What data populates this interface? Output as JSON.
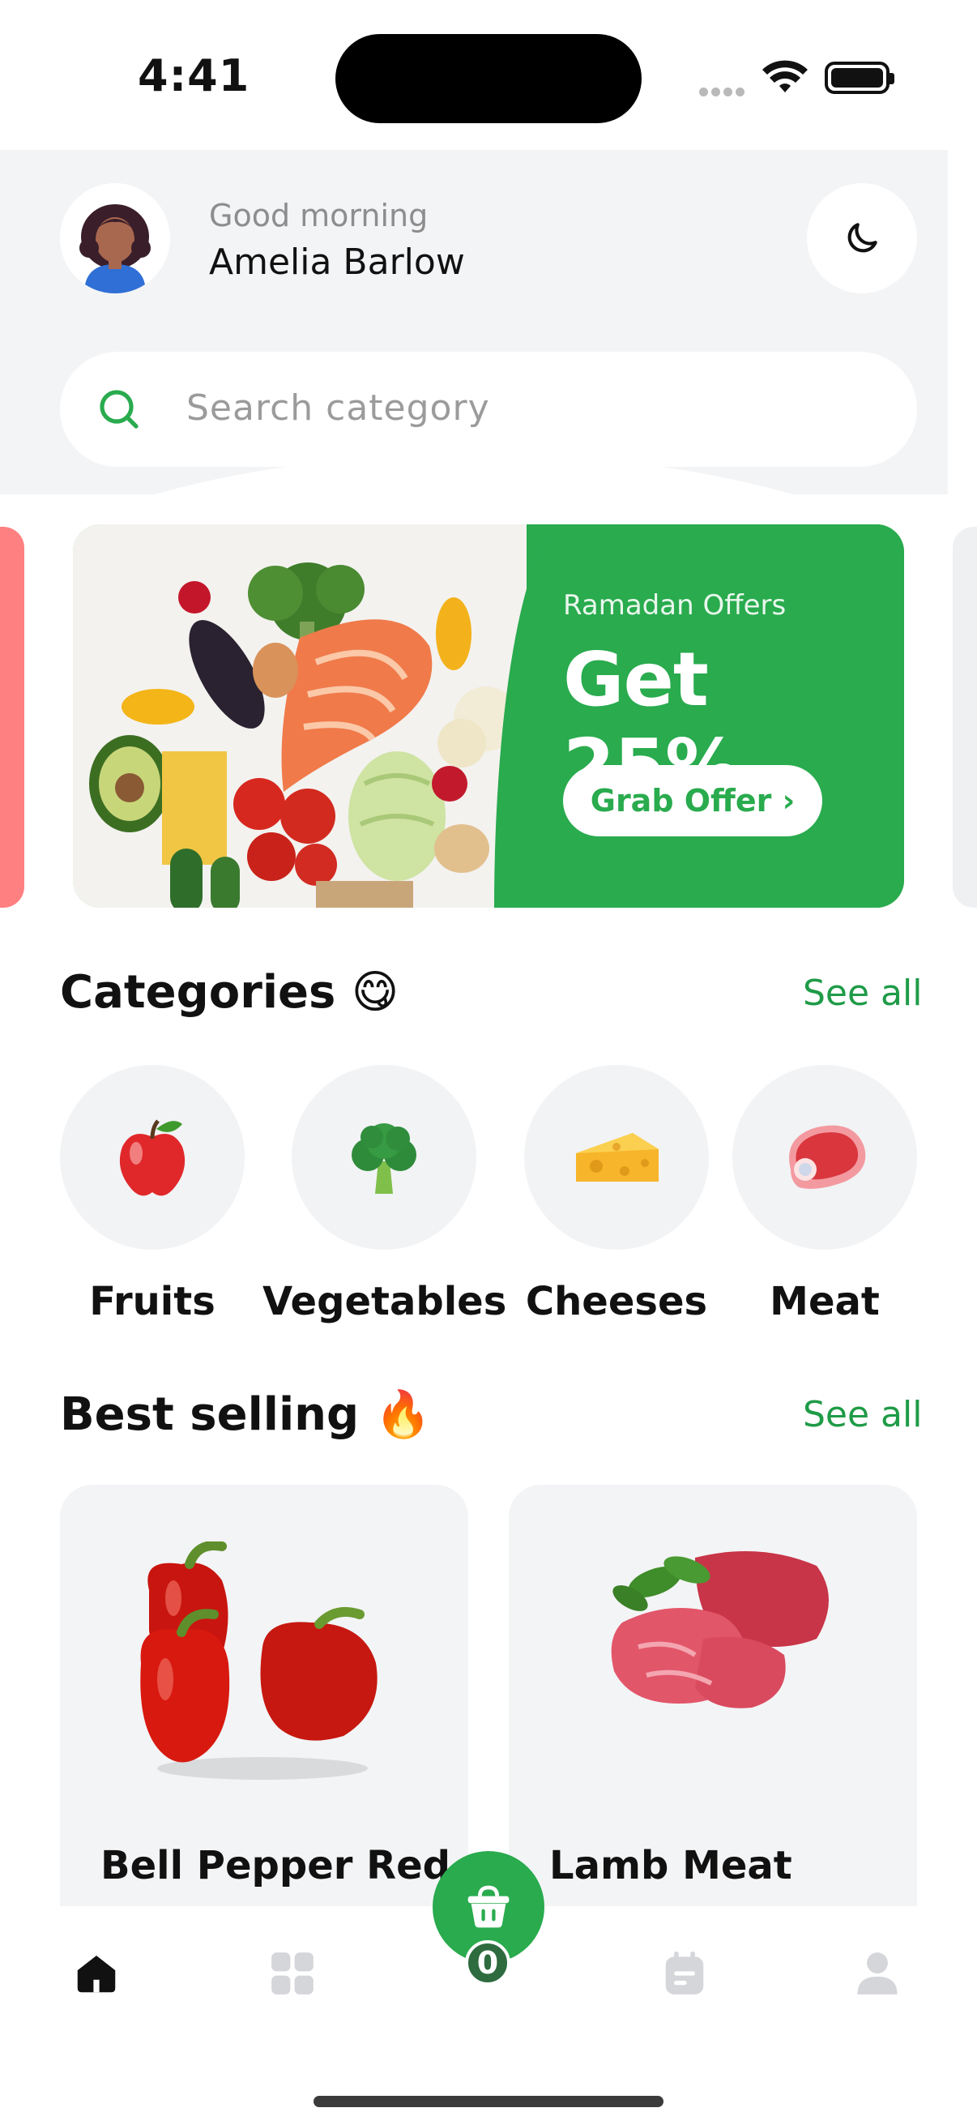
{
  "status_bar": {
    "time": "4:41"
  },
  "header": {
    "greeting": "Good morning",
    "user_name": "Amelia Barlow",
    "theme_toggle_icon": "moon-icon"
  },
  "search": {
    "placeholder": "Search category",
    "icon": "search-icon"
  },
  "banner": {
    "subtitle": "Ramadan Offers",
    "title": "Get 25%",
    "button_label": "Grab Offer ›"
  },
  "categories": {
    "title": "Categories 😋",
    "see_all": "See all",
    "items": [
      {
        "label": "Fruits",
        "icon": "apple-icon"
      },
      {
        "label": "Vegetables",
        "icon": "broccoli-icon"
      },
      {
        "label": "Cheeses",
        "icon": "cheese-icon"
      },
      {
        "label": "Meat",
        "icon": "meat-icon"
      }
    ]
  },
  "best_selling": {
    "title": "Best selling 🔥",
    "see_all": "See all",
    "items": [
      {
        "name": "Bell Pepper Red"
      },
      {
        "name": "Lamb Meat"
      }
    ]
  },
  "bottom_nav": {
    "items": [
      "home-icon",
      "grid-icon",
      "basket-icon",
      "calendar-icon",
      "user-icon"
    ],
    "cart_count": "0",
    "accent": "#29AB4E"
  }
}
